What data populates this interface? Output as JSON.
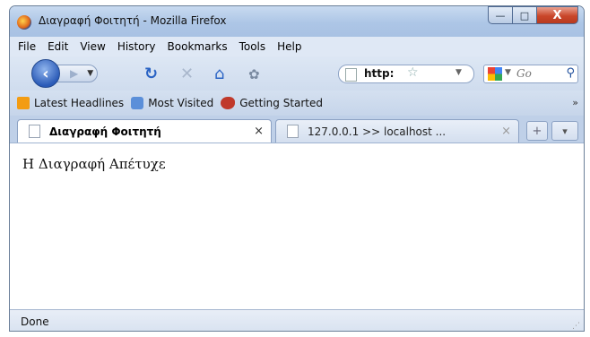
{
  "window": {
    "title": "Διαγραφή Φοιτητή - Mozilla Firefox",
    "controls": {
      "minimize": "—",
      "maximize": "□",
      "close": "X"
    }
  },
  "menu": {
    "items": [
      "File",
      "Edit",
      "View",
      "History",
      "Bookmarks",
      "Tools",
      "Help"
    ]
  },
  "nav": {
    "url": "http:",
    "search_placeholder": "Go"
  },
  "bookmarks": {
    "items": [
      "Latest Headlines",
      "Most Visited",
      "Getting Started"
    ],
    "overflow": "»"
  },
  "tabs": [
    {
      "label": "Διαγραφή Φοιτητή",
      "close": "×"
    },
    {
      "label": "127.0.0.1 >> localhost ...",
      "close": "×"
    }
  ],
  "tab_controls": {
    "new_tab": "+",
    "list": "▾"
  },
  "page": {
    "message": "Η Διαγραφή Απέτυχε"
  },
  "status": {
    "text": "Done"
  }
}
